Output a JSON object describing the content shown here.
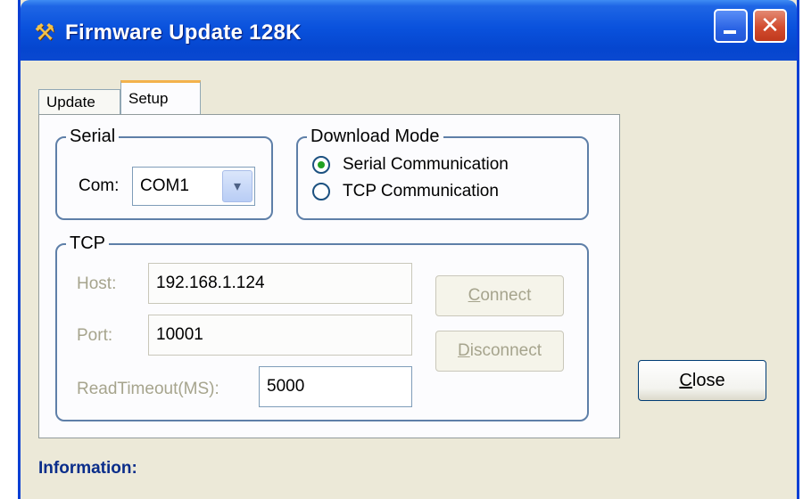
{
  "window": {
    "title": "Firmware Update 128K",
    "title_icon": "wrench-icon",
    "minimize_glyph": "",
    "close_glyph": "✕"
  },
  "tabs": [
    {
      "label": "Update",
      "selected": false
    },
    {
      "label": "Setup",
      "selected": true
    }
  ],
  "serial": {
    "group_title": "Serial",
    "com_label": "Com:",
    "com_value": "COM1",
    "dropdown_glyph": "▾"
  },
  "download_mode": {
    "group_title": "Download Mode",
    "options": [
      {
        "label": "Serial Communication",
        "selected": true
      },
      {
        "label": "TCP Communication",
        "selected": false
      }
    ]
  },
  "tcp": {
    "group_title": "TCP",
    "host_label": "Host:",
    "host_value": "192.168.1.124",
    "port_label": "Port:",
    "port_value": "10001",
    "timeout_label": "ReadTimeout(MS):",
    "timeout_value": "5000",
    "connect_mnemonic": "C",
    "connect_rest": "onnect",
    "disconnect_mnemonic": "D",
    "disconnect_rest": "isconnect"
  },
  "close_button": {
    "mnemonic": "C",
    "rest": "lose"
  },
  "information_label": "Information:",
  "colors": {
    "titlebar": "#0a52dd",
    "window_bg": "#ece9d8",
    "group_border": "#5e7fa8",
    "info_text": "#0a2d8a",
    "radio_selected": "#21a121",
    "tab_accent": "#f3b24c"
  }
}
